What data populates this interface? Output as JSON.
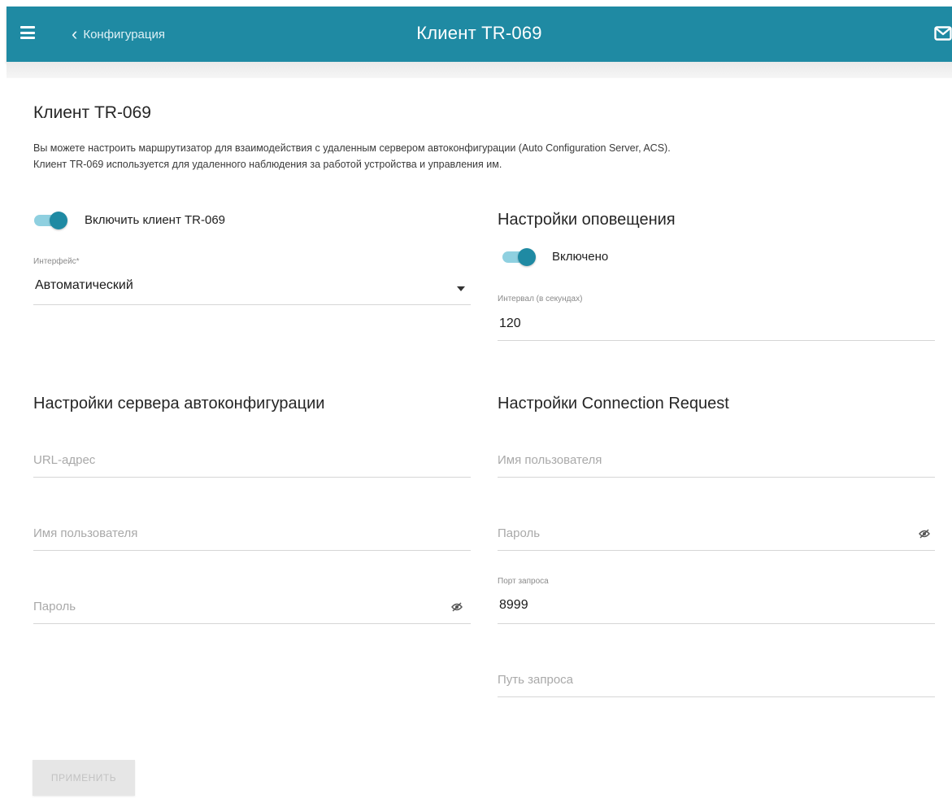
{
  "header": {
    "back_label": "Конфигурация",
    "title": "Клиент TR-069"
  },
  "page": {
    "title": "Клиент TR-069",
    "description_line1": "Вы можете настроить маршрутизатор для взаимодействия с удаленным сервером автоконфигурации (Auto Configuration Server, ACS).",
    "description_line2": "Клиент TR-069 используется для удаленного наблюдения за работой устройства и управления им."
  },
  "client": {
    "enable_label": "Включить клиент TR-069",
    "enabled": true,
    "interface_label": "Интерфейс*",
    "interface_value": "Автоматический"
  },
  "notify": {
    "title": "Настройки оповещения",
    "toggle_label": "Включено",
    "enabled": true,
    "interval_label": "Интервал (в секундах)",
    "interval_value": "120"
  },
  "acs": {
    "title": "Настройки сервера автоконфигурации",
    "url_placeholder": "URL-адрес",
    "username_placeholder": "Имя пользователя",
    "password_placeholder": "Пароль"
  },
  "conn_request": {
    "title": "Настройки Connection Request",
    "username_placeholder": "Имя пользователя",
    "password_placeholder": "Пароль",
    "port_label": "Порт запроса",
    "port_value": "8999",
    "path_placeholder": "Путь запроса"
  },
  "actions": {
    "apply_label": "ПРИМЕНИТЬ"
  },
  "colors": {
    "accent": "#1f8aa3",
    "toggle_track": "#8fd0e0"
  }
}
